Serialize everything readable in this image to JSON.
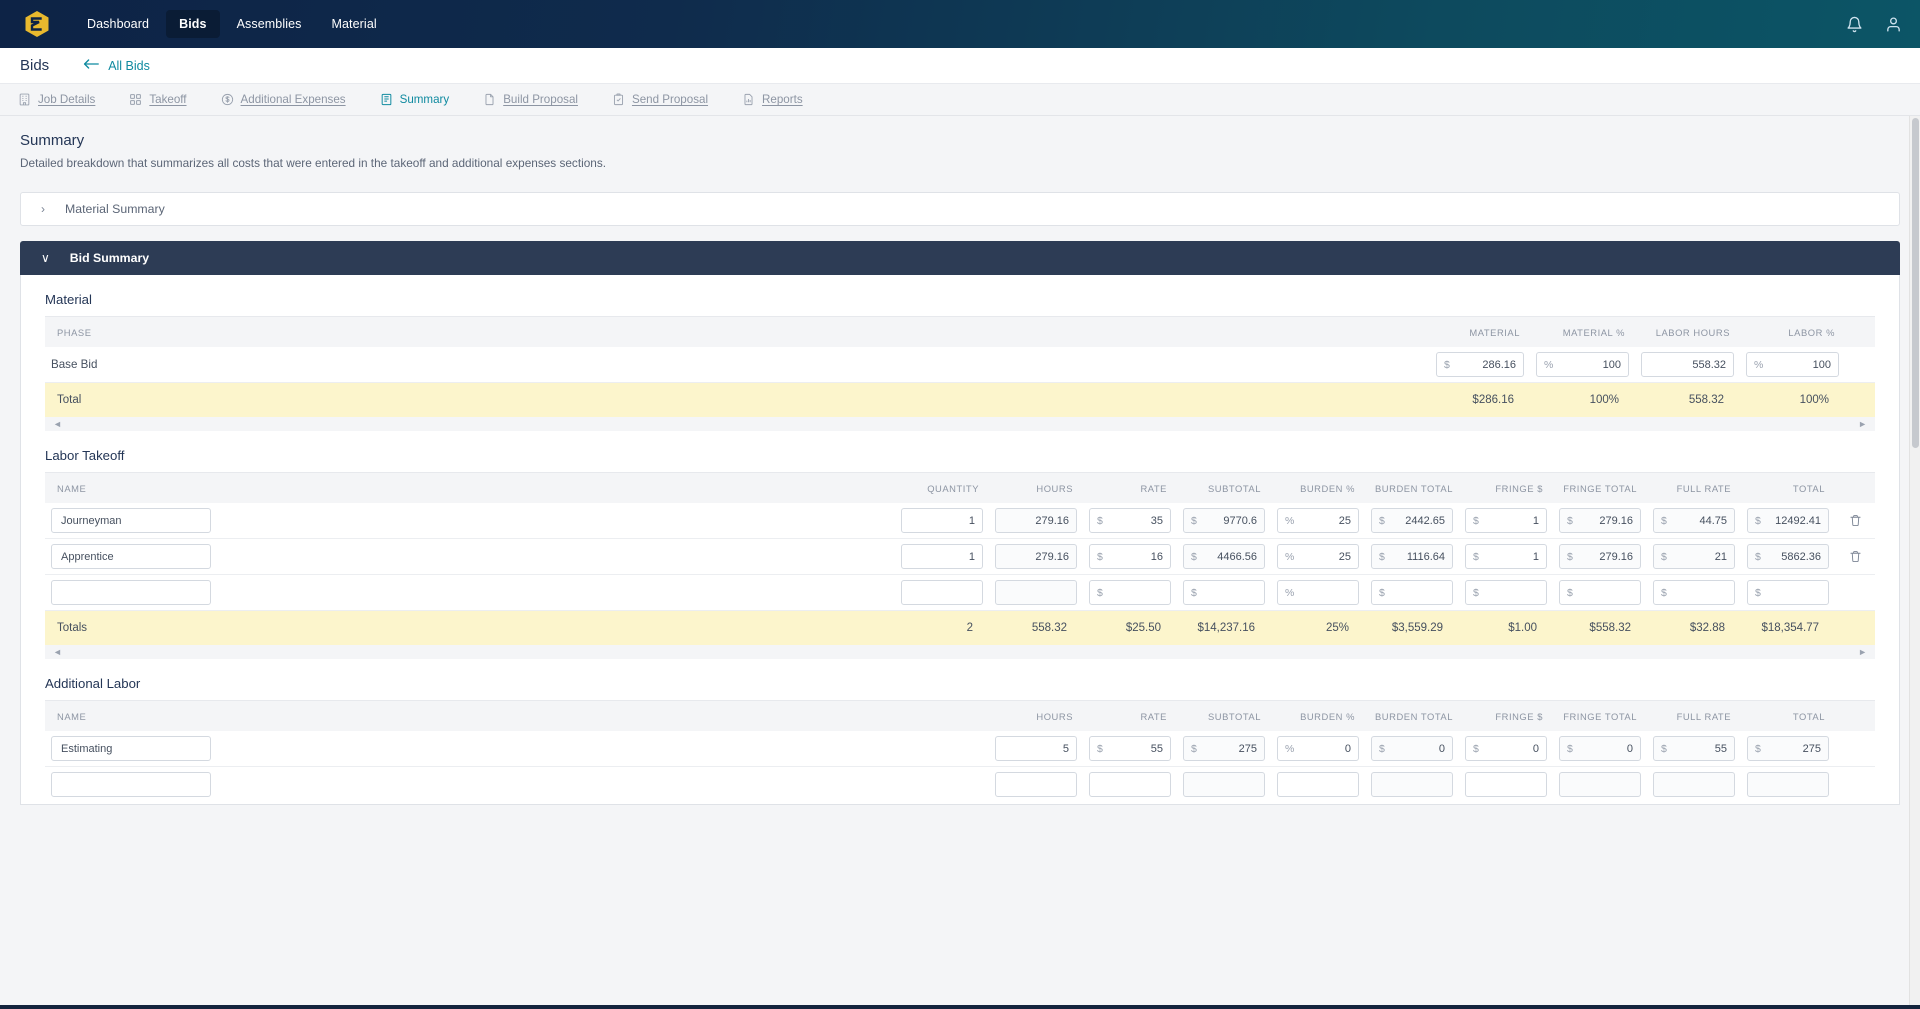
{
  "app": {
    "logo_icon": "hexagon-e-logo",
    "nav_items": [
      {
        "label": "Dashboard",
        "active": false
      },
      {
        "label": "Bids",
        "active": true
      },
      {
        "label": "Assemblies",
        "active": false
      },
      {
        "label": "Material",
        "active": false
      }
    ],
    "nav_right": [
      {
        "icon": "bell-icon",
        "name": "notifications-button"
      },
      {
        "icon": "user-icon",
        "name": "account-button"
      }
    ]
  },
  "breadcrumb": {
    "title": "Bids",
    "back_icon": "arrow-left-icon",
    "back_label": "All Bids"
  },
  "tabs": [
    {
      "label": "Job Details",
      "icon": "building-icon",
      "active": false
    },
    {
      "label": "Takeoff",
      "icon": "grid-squares-icon",
      "active": false
    },
    {
      "label": "Additional Expenses",
      "icon": "dollar-circle-icon",
      "active": false
    },
    {
      "label": "Summary",
      "icon": "summary-list-icon",
      "active": true
    },
    {
      "label": "Build Proposal",
      "icon": "document-icon",
      "active": false
    },
    {
      "label": "Send Proposal",
      "icon": "clipboard-check-icon",
      "active": false
    },
    {
      "label": "Reports",
      "icon": "report-chart-icon",
      "active": false
    }
  ],
  "page": {
    "title": "Summary",
    "subtitle": "Detailed breakdown that summarizes all costs that were entered in the takeoff and additional expenses sections."
  },
  "accordions": {
    "material_summary": {
      "label": "Material Summary",
      "caret": "›",
      "expanded": false
    },
    "bid_summary": {
      "label": "Bid Summary",
      "caret": "∨",
      "expanded": true
    }
  },
  "material_section": {
    "heading": "Material",
    "columns": [
      "PHASE",
      "MATERIAL",
      "MATERIAL %",
      "LABOR HOURS",
      "LABOR %"
    ],
    "rows": [
      {
        "phase": "Base Bid",
        "material": {
          "prefix": "$",
          "value": "286.16"
        },
        "material_pct": {
          "prefix": "%",
          "value": "100"
        },
        "labor_hours": {
          "prefix": "",
          "value": "558.32"
        },
        "labor_pct": {
          "prefix": "%",
          "value": "100"
        }
      }
    ],
    "total": {
      "label": "Total",
      "material": "$286.16",
      "material_pct": "100%",
      "labor_hours": "558.32",
      "labor_pct": "100%"
    }
  },
  "labor_takeoff_section": {
    "heading": "Labor Takeoff",
    "columns": [
      "NAME",
      "QUANTITY",
      "HOURS",
      "RATE",
      "SUBTOTAL",
      "BURDEN %",
      "BURDEN TOTAL",
      "FRINGE $",
      "FRINGE TOTAL",
      "FULL RATE",
      "TOTAL"
    ],
    "rows": [
      {
        "name": "Journeyman",
        "quantity": "1",
        "hours": "279.16",
        "rate": {
          "prefix": "$",
          "value": "35"
        },
        "subtotal": {
          "prefix": "$",
          "value": "9770.6"
        },
        "burden_pct": {
          "prefix": "%",
          "value": "25"
        },
        "burden_total": {
          "prefix": "$",
          "value": "2442.65"
        },
        "fringe": {
          "prefix": "$",
          "value": "1"
        },
        "fringe_total": {
          "prefix": "$",
          "value": "279.16"
        },
        "full_rate": {
          "prefix": "$",
          "value": "44.75"
        },
        "total": {
          "prefix": "$",
          "value": "12492.41"
        },
        "delete_icon": "trash-icon"
      },
      {
        "name": "Apprentice",
        "quantity": "1",
        "hours": "279.16",
        "rate": {
          "prefix": "$",
          "value": "16"
        },
        "subtotal": {
          "prefix": "$",
          "value": "4466.56"
        },
        "burden_pct": {
          "prefix": "%",
          "value": "25"
        },
        "burden_total": {
          "prefix": "$",
          "value": "1116.64"
        },
        "fringe": {
          "prefix": "$",
          "value": "1"
        },
        "fringe_total": {
          "prefix": "$",
          "value": "279.16"
        },
        "full_rate": {
          "prefix": "$",
          "value": "21"
        },
        "total": {
          "prefix": "$",
          "value": "5862.36"
        },
        "delete_icon": "trash-icon"
      },
      {
        "name": "",
        "quantity": "",
        "hours": "",
        "rate": {
          "prefix": "$",
          "value": ""
        },
        "subtotal": {
          "prefix": "$",
          "value": ""
        },
        "burden_pct": {
          "prefix": "%",
          "value": ""
        },
        "burden_total": {
          "prefix": "$",
          "value": ""
        },
        "fringe": {
          "prefix": "$",
          "value": ""
        },
        "fringe_total": {
          "prefix": "$",
          "value": ""
        },
        "full_rate": {
          "prefix": "$",
          "value": ""
        },
        "total": {
          "prefix": "$",
          "value": ""
        },
        "delete_icon": ""
      }
    ],
    "totals": {
      "label": "Totals",
      "quantity": "2",
      "hours": "558.32",
      "rate": "$25.50",
      "subtotal": "$14,237.16",
      "burden_pct": "25%",
      "burden_total": "$3,559.29",
      "fringe": "$1.00",
      "fringe_total": "$558.32",
      "full_rate": "$32.88",
      "total": "$18,354.77"
    }
  },
  "additional_labor_section": {
    "heading": "Additional Labor",
    "columns": [
      "NAME",
      "HOURS",
      "RATE",
      "SUBTOTAL",
      "BURDEN %",
      "BURDEN TOTAL",
      "FRINGE $",
      "FRINGE TOTAL",
      "FULL RATE",
      "TOTAL"
    ],
    "rows": [
      {
        "name": "Estimating",
        "hours": "5",
        "rate": {
          "prefix": "$",
          "value": "55"
        },
        "subtotal": {
          "prefix": "$",
          "value": "275"
        },
        "burden_pct": {
          "prefix": "%",
          "value": "0"
        },
        "burden_total": {
          "prefix": "$",
          "value": "0"
        },
        "fringe": {
          "prefix": "$",
          "value": "0"
        },
        "fringe_total": {
          "prefix": "$",
          "value": "0"
        },
        "full_rate": {
          "prefix": "$",
          "value": "55"
        },
        "total": {
          "prefix": "$",
          "value": "275"
        }
      }
    ]
  },
  "scrollbars": {
    "left_arrow": "◄",
    "right_arrow": "►"
  },
  "colors": {
    "nav_start": "#0d2346",
    "nav_end": "#0c5566",
    "accent_teal": "#0f8aa0",
    "dark_panel": "#2d3c55",
    "total_row": "#fcf5cc",
    "logo_gold": "#e8b92e"
  }
}
